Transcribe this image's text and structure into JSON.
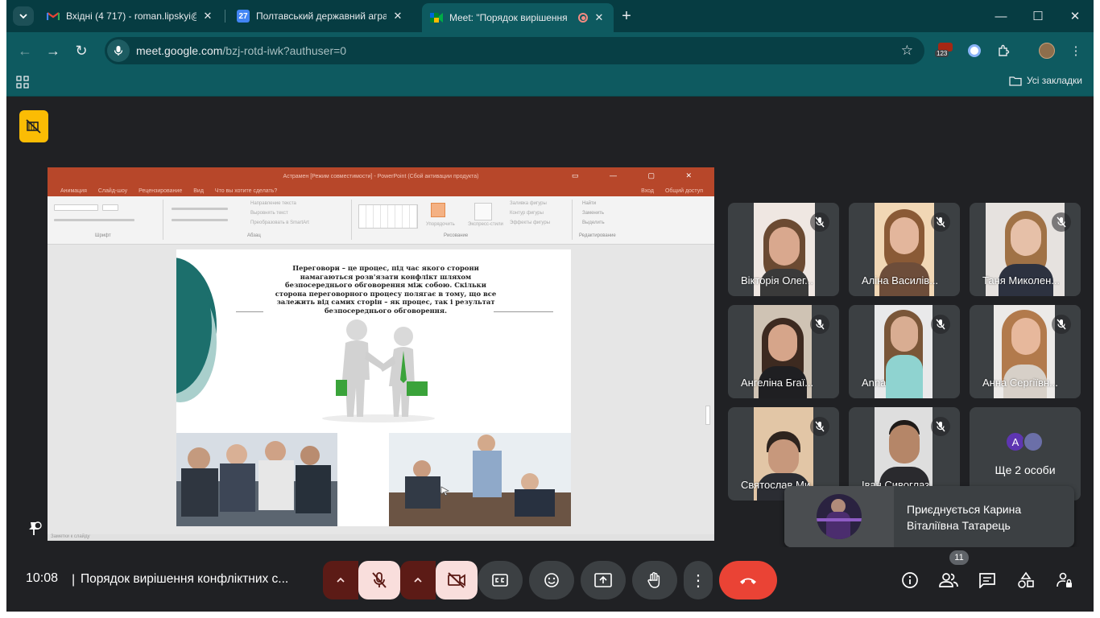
{
  "browser": {
    "tabs": [
      {
        "title": "Вхідні (4 717) - roman.lipskyi@p",
        "favicon": "gmail-icon",
        "active": false
      },
      {
        "title": "Полтавський державний аграр",
        "favicon": "calendar-icon",
        "favicon_text": "27",
        "active": false
      },
      {
        "title": "Meet: \"Порядок вирішення",
        "favicon": "meet-icon",
        "active": true,
        "recording": true
      }
    ],
    "url_host": "meet.google.com",
    "url_path": "/bzj-rotd-iwk?authuser=0",
    "extension_badge": "123",
    "bookmarks_folder": "Усі закладки"
  },
  "presentation": {
    "window_title": "Астрамен [Режим совместимости] - PowerPoint (Сбой активации продукта)",
    "menu": [
      "Анимация",
      "Слайд-шоу",
      "Рецензирование",
      "Вид",
      "Что вы хотите сделать?"
    ],
    "menu_right": "Вход",
    "share_label": "Общий доступ",
    "ribbon_groups": [
      "Шрифт",
      "Абзац",
      "Рисование",
      "Редактирование"
    ],
    "ribbon_items": [
      "Направление текста",
      "Выровнять текст",
      "Преобразовать в SmartArt",
      "Упорядочить",
      "Экспресс-стили",
      "Заливка фигуры",
      "Контур фигуры",
      "Эффекты фигуры",
      "Найти",
      "Заменить",
      "Выделить"
    ],
    "slide_text": "Переговори – це процес, під час якого сторони намагаються розв'язати конфлікт шляхом безпосереднього обговорення між собою. Скільки сторона переговорного процесу полягає в тому, що все залежить від самих сторін – як процес, так і результат безпосереднього обговорення.",
    "status_text": "Заметки к слайду"
  },
  "participants": [
    {
      "name": "Вікторія Олег...",
      "skin": "#d9a88e",
      "bg": "#efe7e2",
      "hair": "#6b4a32"
    },
    {
      "name": "Аліна Василів...",
      "skin": "#e3b69c",
      "bg": "#f1d7b5",
      "hair": "#8a5a36"
    },
    {
      "name": "Таня Миколен...",
      "skin": "#e6c0a8",
      "bg": "#e6e2df",
      "hair": "#a07246"
    },
    {
      "name": "Ангеліна Бraї...",
      "skin": "#d6a58a",
      "bg": "#cfc3b4",
      "hair": "#3d2a20"
    },
    {
      "name": "Anna",
      "skin": "#d9ad92",
      "bg": "#e9e9ea",
      "hair": "#7a5638"
    },
    {
      "name": "Анна Сергіївн...",
      "skin": "#e7b89c",
      "bg": "#eceae8",
      "hair": "#b27a4c"
    },
    {
      "name": "Святослав Ми...",
      "skin": "#c7987c",
      "bg": "#e2c6a6",
      "hair": "#2e241e"
    },
    {
      "name": "Іван Сивоглаз",
      "skin": "#b58668",
      "bg": "#dedede",
      "hair": "#1e1a18"
    }
  ],
  "more_tile": {
    "label": "Ще 2 особи",
    "avatar_letter": "A",
    "avatar_color": "#5e35b1"
  },
  "toast": {
    "message": "Приєднується Карина Віталіївна Татарець"
  },
  "meeting": {
    "time": "10:08",
    "title": "Порядок вирішення конфліктних с...",
    "people_count": "11"
  },
  "colors": {
    "accent_danger": "#ea4335",
    "muted_control_bg": "#f9dedc",
    "chrome_frame": "#063c42",
    "chrome_toolbar": "#0e5a60",
    "hidden_tile_badge": "#fbbc04"
  }
}
